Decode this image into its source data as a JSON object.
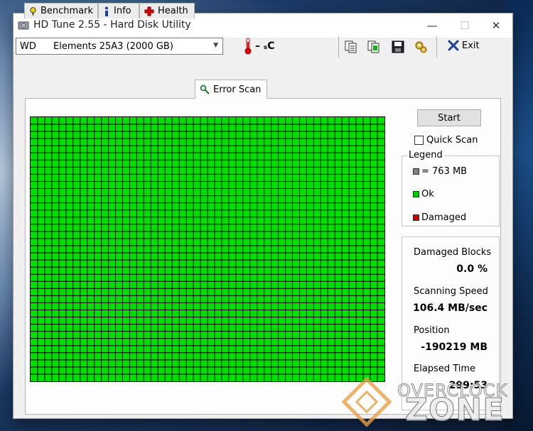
{
  "window": {
    "title": "HD Tune 2.55 - Hard Disk Utility",
    "controls": {
      "minimize": "—",
      "maximize": "☐",
      "close": "✕"
    }
  },
  "toolbar": {
    "drive_name": "WD",
    "drive_model": "Elements 25A3 (2000 GB)",
    "temperature": "– ₛC",
    "exit_label": "Exit",
    "icons": [
      "copy-info-icon",
      "copy-screen-icon",
      "save-icon",
      "options-icon",
      "exit-icon"
    ]
  },
  "tabs": [
    {
      "label": "Benchmark",
      "icon": "benchmark-icon"
    },
    {
      "label": "Info",
      "icon": "info-icon"
    },
    {
      "label": "Health",
      "icon": "health-icon"
    },
    {
      "label": "Error Scan",
      "icon": "search-icon",
      "active": true
    }
  ],
  "scan": {
    "start_label": "Start",
    "quick_scan_label": "Quick Scan",
    "quick_scan_checked": false,
    "block_grid": {
      "columns": 50,
      "rows": 37,
      "status": "Ok"
    }
  },
  "legend": {
    "title": "Legend",
    "items": [
      {
        "label": "= 763 MB",
        "color": "#808080"
      },
      {
        "label": "Ok",
        "color": "#00cc00"
      },
      {
        "label": "Damaged",
        "color": "#cc0000"
      }
    ]
  },
  "stats": {
    "damaged_blocks_label": "Damaged Blocks",
    "damaged_blocks_value": "0.0 %",
    "scanning_speed_label": "Scanning Speed",
    "scanning_speed_value": "106.4 MB/sec",
    "position_label": "Position",
    "position_value": "-190219 MB",
    "elapsed_time_label": "Elapsed Time",
    "elapsed_time_value": "299:53"
  },
  "watermark": {
    "line1": "OVERCLOCK",
    "line2": "ZONE"
  },
  "colors": {
    "block_ok": "#00e000",
    "block_line": "#000000",
    "window_bg": "#f0f0f0"
  }
}
